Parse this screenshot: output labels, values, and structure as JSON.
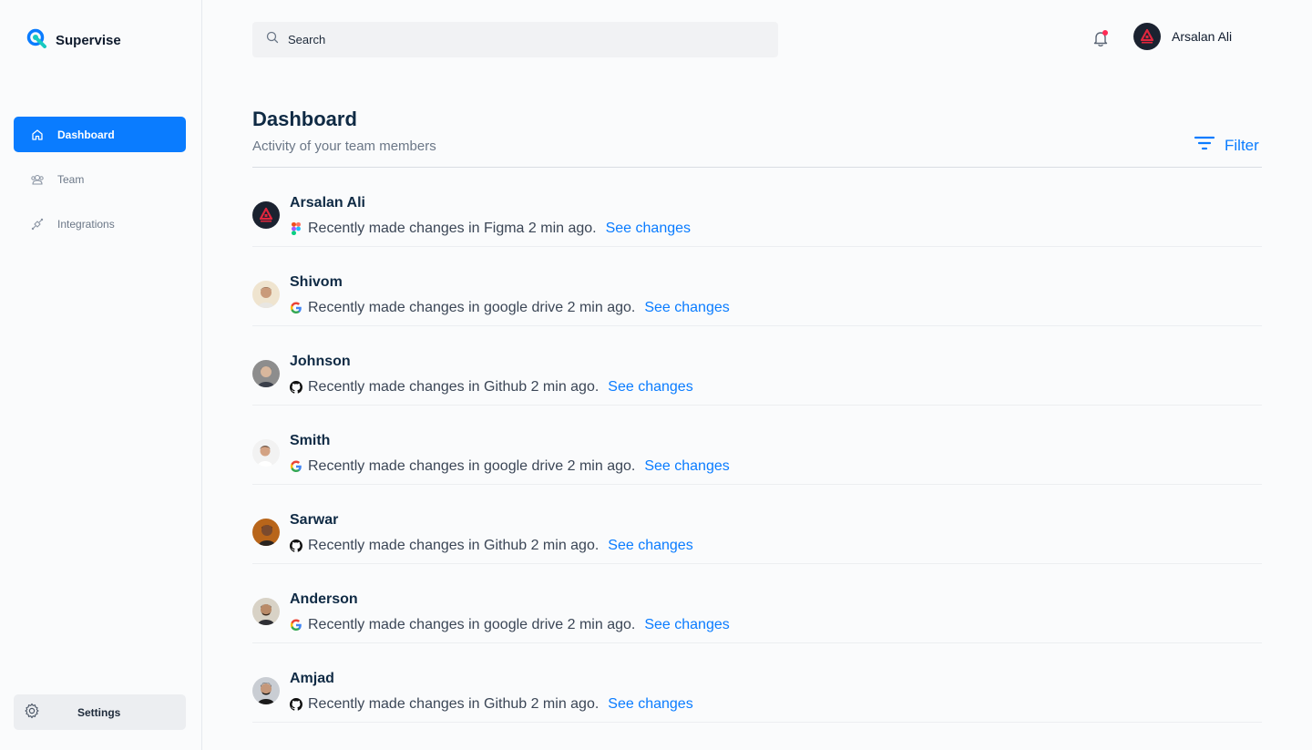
{
  "brand": {
    "name": "Supervise"
  },
  "sidebar": {
    "items": [
      {
        "label": "Dashboard",
        "icon": "home-icon",
        "active": true
      },
      {
        "label": "Team",
        "icon": "team-icon",
        "active": false
      },
      {
        "label": "Integrations",
        "icon": "integrations-icon",
        "active": false
      }
    ],
    "settings_label": "Settings"
  },
  "topbar": {
    "search_placeholder": "Search",
    "user_name": "Arsalan Ali",
    "notification_dot_color": "#ff2a55"
  },
  "main": {
    "title": "Dashboard",
    "subtitle": "Activity of your team members",
    "filter_label": "Filter"
  },
  "activity": [
    {
      "name": "Arsalan Ali",
      "app": "figma-icon",
      "text": "Recently made changes in Figma 2 min ago.",
      "link": "See changes"
    },
    {
      "name": "Shivom",
      "app": "google-icon",
      "text": "Recently made changes in google drive 2 min ago.",
      "link": "See changes"
    },
    {
      "name": "Johnson",
      "app": "github-icon",
      "text": "Recently made changes in Github 2 min ago.",
      "link": "See changes"
    },
    {
      "name": "Smith",
      "app": "google-icon",
      "text": "Recently made changes in google drive 2 min ago.",
      "link": "See changes"
    },
    {
      "name": "Sarwar",
      "app": "github-icon",
      "text": "Recently made changes in Github 2 min ago.",
      "link": "See changes"
    },
    {
      "name": "Anderson",
      "app": "google-icon",
      "text": "Recently made changes in google drive 2 min ago.",
      "link": "See changes"
    },
    {
      "name": "Amjad",
      "app": "github-icon",
      "text": "Recently made changes in Github 2 min ago.",
      "link": "See changes"
    }
  ],
  "colors": {
    "accent": "#0a7cff",
    "title": "#0f2a44",
    "muted": "#6b7787"
  }
}
